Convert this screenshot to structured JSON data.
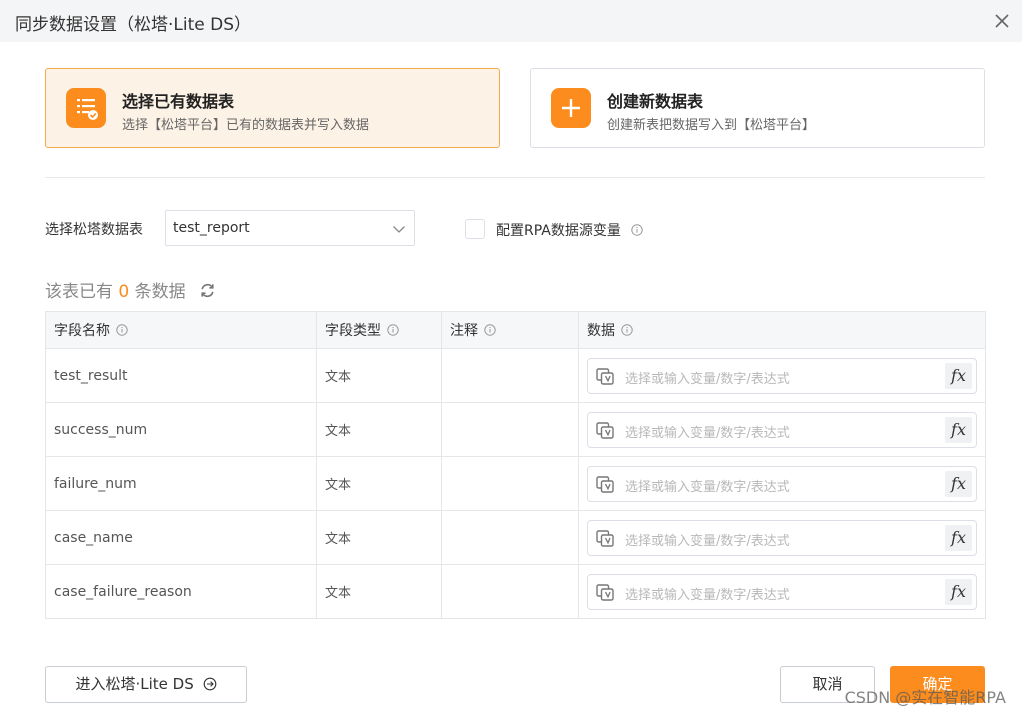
{
  "dialog": {
    "title": "同步数据设置（松塔·Lite DS）"
  },
  "mode_cards": [
    {
      "title": "选择已有数据表",
      "desc": "选择【松塔平台】已有的数据表并写入数据",
      "icon": "list-check-icon",
      "selected": true
    },
    {
      "title": "创建新数据表",
      "desc": "创建新表把数据写入到【松塔平台】",
      "icon": "plus-icon",
      "selected": false
    }
  ],
  "table_select": {
    "label": "选择松塔数据表",
    "value": "test_report"
  },
  "rpa_checkbox": {
    "label": "配置RPA数据源变量",
    "checked": false
  },
  "record_count": {
    "prefix": "该表已有",
    "count": "0",
    "suffix": "条数据"
  },
  "fields_table": {
    "headers": [
      "字段名称",
      "字段类型",
      "注释",
      "数据"
    ],
    "placeholder": "选择或输入变量/数字/表达式",
    "fx_label": "fx",
    "rows": [
      {
        "name": "test_result",
        "type": "文本",
        "comment": ""
      },
      {
        "name": "success_num",
        "type": "文本",
        "comment": ""
      },
      {
        "name": "failure_num",
        "type": "文本",
        "comment": ""
      },
      {
        "name": "case_name",
        "type": "文本",
        "comment": ""
      },
      {
        "name": "case_failure_reason",
        "type": "文本",
        "comment": ""
      }
    ]
  },
  "footer": {
    "enter_label": "进入松塔·Lite DS",
    "cancel_label": "取消",
    "ok_label": "确定"
  },
  "watermark": "CSDN @实在智能RPA",
  "colors": {
    "accent": "#fb8c1d",
    "accent_bg": "#fdf2e6",
    "border": "#dcdfe6"
  }
}
